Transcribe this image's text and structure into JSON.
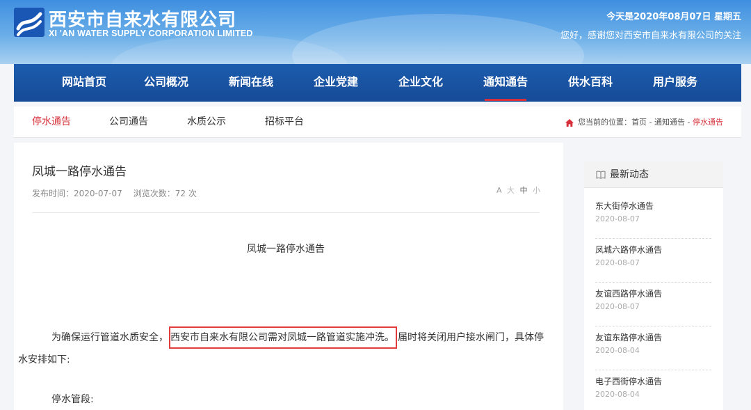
{
  "header": {
    "brand_cn": "西安市自来水有限公司",
    "brand_en": "XI 'AN WATER SUPPLY CORPORATION LIMITED",
    "date": "今天是2020年08月07日 星期五",
    "greeting": "您好，感谢您对西安市自来水有限公司的关注"
  },
  "nav": {
    "items": [
      {
        "label": "网站首页"
      },
      {
        "label": "公司概况"
      },
      {
        "label": "新闻在线"
      },
      {
        "label": "企业党建"
      },
      {
        "label": "企业文化"
      },
      {
        "label": "通知通告",
        "active": true
      },
      {
        "label": "供水百科"
      },
      {
        "label": "用户服务"
      }
    ]
  },
  "subnav": {
    "items": [
      {
        "label": "停水通告",
        "active": true
      },
      {
        "label": "公司通告"
      },
      {
        "label": "水质公示"
      },
      {
        "label": "招标平台"
      }
    ]
  },
  "breadcrumb": {
    "prefix": "您当前的位置：",
    "home": "首页",
    "sep1": " - ",
    "section": "通知通告",
    "sep2": " - ",
    "current": "停水通告"
  },
  "article": {
    "title": "凤城一路停水通告",
    "publish": "发布时间：2020-07-07",
    "views": "浏览次数：72 次",
    "font_icon": "A",
    "font_large": "大",
    "font_medium": "中",
    "font_small": "小",
    "center_title": "凤城一路停水通告",
    "para_before": "为确保运行管道水质安全，",
    "para_highlight": "西安市自来水有限公司需对凤城一路管道实施冲洗。",
    "para_after": "届时将关闭用户接水闸门，具体停",
    "para_line2": "水安排如下:",
    "section_label": "停水管段:"
  },
  "sidebar": {
    "title": "最新动态",
    "items": [
      {
        "title": "东大街停水通告",
        "date": "2020-08-07"
      },
      {
        "title": "凤城六路停水通告",
        "date": "2020-08-07"
      },
      {
        "title": "友谊西路停水通告",
        "date": "2020-08-07"
      },
      {
        "title": "友谊东路停水通告",
        "date": "2020-08-04"
      },
      {
        "title": "电子西街停水通告",
        "date": "2020-08-04"
      }
    ]
  },
  "colors": {
    "accent_red": "#d7303a",
    "nav_blue": "#1c5cae",
    "highlight_border": "#e23d3d"
  }
}
